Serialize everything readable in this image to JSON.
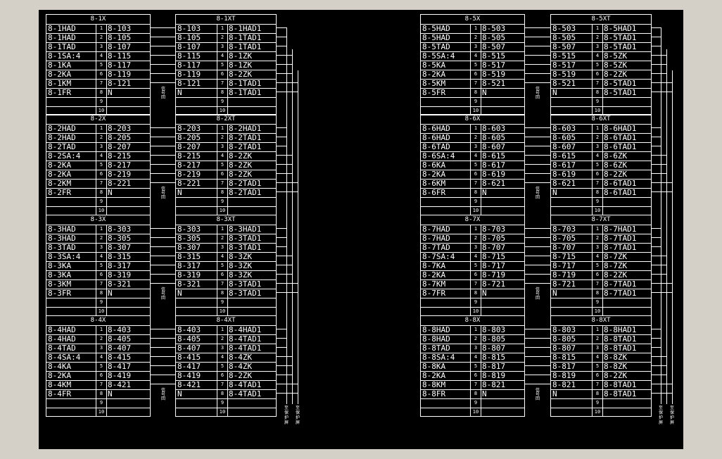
{
  "neutral_label": "N",
  "side_tags": [
    "信",
    "号",
    "回"
  ],
  "cable_labels": [
    "至",
    "保",
    "护",
    "屏"
  ],
  "columns": [
    {
      "sections": [
        {
          "x_title": "8-1X",
          "xt_title": "8-1XT",
          "x_rows": [
            [
              "8-1HAD",
              "1",
              "8-103"
            ],
            [
              "8-1HAD",
              "2",
              "8-105"
            ],
            [
              "8-1TAD",
              "3",
              "8-107"
            ],
            [
              "8-1SA:4",
              "4",
              "8-115"
            ],
            [
              "8-1KA",
              "5",
              "8-117"
            ],
            [
              "8-2KA",
              "6",
              "8-119"
            ],
            [
              "8-1KM",
              "7",
              "8-121"
            ],
            [
              "8-1FR",
              "8",
              "N"
            ],
            [
              "",
              "9",
              ""
            ],
            [
              "",
              "10",
              ""
            ]
          ],
          "xt_rows": [
            [
              "8-103",
              "1",
              "8-1HAD1"
            ],
            [
              "8-105",
              "2",
              "8-1TAD1"
            ],
            [
              "8-107",
              "3",
              "8-1TAD1"
            ],
            [
              "8-115",
              "4",
              "8-1ZK"
            ],
            [
              "8-117",
              "5",
              "8-1ZK"
            ],
            [
              "8-119",
              "6",
              "8-2ZK"
            ],
            [
              "8-121",
              "7",
              "8-1TAD1"
            ],
            [
              "N",
              "8",
              "8-1TAD1"
            ],
            [
              "",
              "9",
              ""
            ],
            [
              "",
              "10",
              ""
            ]
          ]
        },
        {
          "x_title": "8-2X",
          "xt_title": "8-2XT",
          "x_rows": [
            [
              "8-2HAD",
              "1",
              "8-203"
            ],
            [
              "8-2HAD",
              "2",
              "8-205"
            ],
            [
              "8-2TAD",
              "3",
              "8-207"
            ],
            [
              "8-2SA:4",
              "4",
              "8-215"
            ],
            [
              "8-2KA",
              "5",
              "8-217"
            ],
            [
              "8-2KA",
              "6",
              "8-219"
            ],
            [
              "8-2KM",
              "7",
              "8-221"
            ],
            [
              "8-2FR",
              "8",
              "N"
            ],
            [
              "",
              "9",
              ""
            ],
            [
              "",
              "10",
              ""
            ]
          ],
          "xt_rows": [
            [
              "8-203",
              "1",
              "8-2HAD1"
            ],
            [
              "8-205",
              "2",
              "8-2TAD1"
            ],
            [
              "8-207",
              "3",
              "8-2TAD1"
            ],
            [
              "8-215",
              "4",
              "8-2ZK"
            ],
            [
              "8-217",
              "5",
              "8-2ZK"
            ],
            [
              "8-219",
              "6",
              "8-2ZK"
            ],
            [
              "8-221",
              "7",
              "8-2TAD1"
            ],
            [
              "N",
              "8",
              "8-2TAD1"
            ],
            [
              "",
              "9",
              ""
            ],
            [
              "",
              "10",
              ""
            ]
          ]
        },
        {
          "x_title": "8-3X",
          "xt_title": "8-3XT",
          "x_rows": [
            [
              "8-3HAD",
              "1",
              "8-303"
            ],
            [
              "8-3HAD",
              "2",
              "8-305"
            ],
            [
              "8-3TAD",
              "3",
              "8-307"
            ],
            [
              "8-3SA:4",
              "4",
              "8-315"
            ],
            [
              "8-3KA",
              "5",
              "8-317"
            ],
            [
              "8-3KA",
              "6",
              "8-319"
            ],
            [
              "8-3KM",
              "7",
              "8-321"
            ],
            [
              "8-3FR",
              "8",
              "N"
            ],
            [
              "",
              "9",
              ""
            ],
            [
              "",
              "10",
              ""
            ]
          ],
          "xt_rows": [
            [
              "8-303",
              "1",
              "8-3HAD1"
            ],
            [
              "8-305",
              "2",
              "8-3TAD1"
            ],
            [
              "8-307",
              "3",
              "8-3TAD1"
            ],
            [
              "8-315",
              "4",
              "8-3ZK"
            ],
            [
              "8-317",
              "5",
              "8-3ZK"
            ],
            [
              "8-319",
              "6",
              "8-3ZK"
            ],
            [
              "8-321",
              "7",
              "8-3TAD1"
            ],
            [
              "N",
              "8",
              "8-3TAD1"
            ],
            [
              "",
              "9",
              ""
            ],
            [
              "",
              "10",
              ""
            ]
          ]
        },
        {
          "x_title": "8-4X",
          "xt_title": "8-4XT",
          "x_rows": [
            [
              "8-4HAD",
              "1",
              "8-403"
            ],
            [
              "8-4HAD",
              "2",
              "8-405"
            ],
            [
              "8-4TAD",
              "3",
              "8-407"
            ],
            [
              "8-4SA:4",
              "4",
              "8-415"
            ],
            [
              "8-4KA",
              "5",
              "8-417"
            ],
            [
              "8-2KA",
              "6",
              "8-419"
            ],
            [
              "8-4KM",
              "7",
              "8-421"
            ],
            [
              "8-4FR",
              "8",
              "N"
            ],
            [
              "",
              "9",
              ""
            ],
            [
              "",
              "10",
              ""
            ]
          ],
          "xt_rows": [
            [
              "8-403",
              "1",
              "8-4HAD1"
            ],
            [
              "8-405",
              "2",
              "8-4TAD1"
            ],
            [
              "8-407",
              "3",
              "8-4TAD1"
            ],
            [
              "8-415",
              "4",
              "8-4ZK"
            ],
            [
              "8-417",
              "5",
              "8-4ZK"
            ],
            [
              "8-419",
              "6",
              "8-2ZK"
            ],
            [
              "8-421",
              "7",
              "8-4TAD1"
            ],
            [
              "N",
              "8",
              "8-4TAD1"
            ],
            [
              "",
              "9",
              ""
            ],
            [
              "",
              "10",
              ""
            ]
          ]
        }
      ]
    },
    {
      "sections": [
        {
          "x_title": "8-5X",
          "xt_title": "8-5XT",
          "x_rows": [
            [
              "8-5HAD",
              "1",
              "8-503"
            ],
            [
              "8-5HAD",
              "2",
              "8-505"
            ],
            [
              "8-5TAD",
              "3",
              "8-507"
            ],
            [
              "8-5SA:4",
              "4",
              "8-515"
            ],
            [
              "8-5KA",
              "5",
              "8-517"
            ],
            [
              "8-2KA",
              "6",
              "8-519"
            ],
            [
              "8-5KM",
              "7",
              "8-521"
            ],
            [
              "8-5FR",
              "8",
              "N"
            ],
            [
              "",
              "9",
              ""
            ],
            [
              "",
              "10",
              ""
            ]
          ],
          "xt_rows": [
            [
              "8-503",
              "1",
              "8-5HAD1"
            ],
            [
              "8-505",
              "2",
              "8-5TAD1"
            ],
            [
              "8-507",
              "3",
              "8-5TAD1"
            ],
            [
              "8-515",
              "4",
              "8-5ZK"
            ],
            [
              "8-517",
              "5",
              "8-5ZK"
            ],
            [
              "8-519",
              "6",
              "8-2ZK"
            ],
            [
              "8-521",
              "7",
              "8-5TAD1"
            ],
            [
              "N",
              "8",
              "8-5TAD1"
            ],
            [
              "",
              "9",
              ""
            ],
            [
              "",
              "10",
              ""
            ]
          ]
        },
        {
          "x_title": "8-6X",
          "xt_title": "8-6XT",
          "x_rows": [
            [
              "8-6HAD",
              "1",
              "8-603"
            ],
            [
              "8-6HAD",
              "2",
              "8-605"
            ],
            [
              "8-6TAD",
              "3",
              "8-607"
            ],
            [
              "8-6SA:4",
              "4",
              "8-615"
            ],
            [
              "8-6KA",
              "5",
              "8-617"
            ],
            [
              "8-2KA",
              "6",
              "8-619"
            ],
            [
              "8-6KM",
              "7",
              "8-621"
            ],
            [
              "8-6FR",
              "8",
              "N"
            ],
            [
              "",
              "9",
              ""
            ],
            [
              "",
              "10",
              ""
            ]
          ],
          "xt_rows": [
            [
              "8-603",
              "1",
              "8-6HAD1"
            ],
            [
              "8-605",
              "2",
              "8-6TAD1"
            ],
            [
              "8-607",
              "3",
              "8-6TAD1"
            ],
            [
              "8-615",
              "4",
              "8-6ZK"
            ],
            [
              "8-617",
              "5",
              "8-6ZK"
            ],
            [
              "8-619",
              "6",
              "8-2ZK"
            ],
            [
              "8-621",
              "7",
              "8-6TAD1"
            ],
            [
              "N",
              "8",
              "8-6TAD1"
            ],
            [
              "",
              "9",
              ""
            ],
            [
              "",
              "10",
              ""
            ]
          ]
        },
        {
          "x_title": "8-7X",
          "xt_title": "8-7XT",
          "x_rows": [
            [
              "8-7HAD",
              "1",
              "8-703"
            ],
            [
              "8-7HAD",
              "2",
              "8-705"
            ],
            [
              "8-7TAD",
              "3",
              "8-707"
            ],
            [
              "8-7SA:4",
              "4",
              "8-715"
            ],
            [
              "8-7KA",
              "5",
              "8-717"
            ],
            [
              "8-2KA",
              "6",
              "8-719"
            ],
            [
              "8-7KM",
              "7",
              "8-721"
            ],
            [
              "8-7FR",
              "8",
              "N"
            ],
            [
              "",
              "9",
              ""
            ],
            [
              "",
              "10",
              ""
            ]
          ],
          "xt_rows": [
            [
              "8-703",
              "1",
              "8-7HAD1"
            ],
            [
              "8-705",
              "2",
              "8-7TAD1"
            ],
            [
              "8-707",
              "3",
              "8-7TAD1"
            ],
            [
              "8-715",
              "4",
              "8-7ZK"
            ],
            [
              "8-717",
              "5",
              "8-7ZK"
            ],
            [
              "8-719",
              "6",
              "8-2ZK"
            ],
            [
              "8-721",
              "7",
              "8-7TAD1"
            ],
            [
              "N",
              "8",
              "8-7TAD1"
            ],
            [
              "",
              "9",
              ""
            ],
            [
              "",
              "10",
              ""
            ]
          ]
        },
        {
          "x_title": "8-8X",
          "xt_title": "8-8XT",
          "x_rows": [
            [
              "8-8HAD",
              "1",
              "8-803"
            ],
            [
              "8-8HAD",
              "2",
              "8-805"
            ],
            [
              "8-8TAD",
              "3",
              "8-807"
            ],
            [
              "8-8SA:4",
              "4",
              "8-815"
            ],
            [
              "8-8KA",
              "5",
              "8-817"
            ],
            [
              "8-2KA",
              "6",
              "8-819"
            ],
            [
              "8-8KM",
              "7",
              "8-821"
            ],
            [
              "8-8FR",
              "8",
              "N"
            ],
            [
              "",
              "9",
              ""
            ],
            [
              "",
              "10",
              ""
            ]
          ],
          "xt_rows": [
            [
              "8-803",
              "1",
              "8-8HAD1"
            ],
            [
              "8-805",
              "2",
              "8-8TAD1"
            ],
            [
              "8-807",
              "3",
              "8-8TAD1"
            ],
            [
              "8-815",
              "4",
              "8-8ZK"
            ],
            [
              "8-817",
              "5",
              "8-8ZK"
            ],
            [
              "8-819",
              "6",
              "8-2ZK"
            ],
            [
              "8-821",
              "7",
              "8-8TAD1"
            ],
            [
              "N",
              "8",
              "8-8TAD1"
            ],
            [
              "",
              "9",
              ""
            ],
            [
              "",
              "10",
              ""
            ]
          ]
        }
      ]
    }
  ]
}
